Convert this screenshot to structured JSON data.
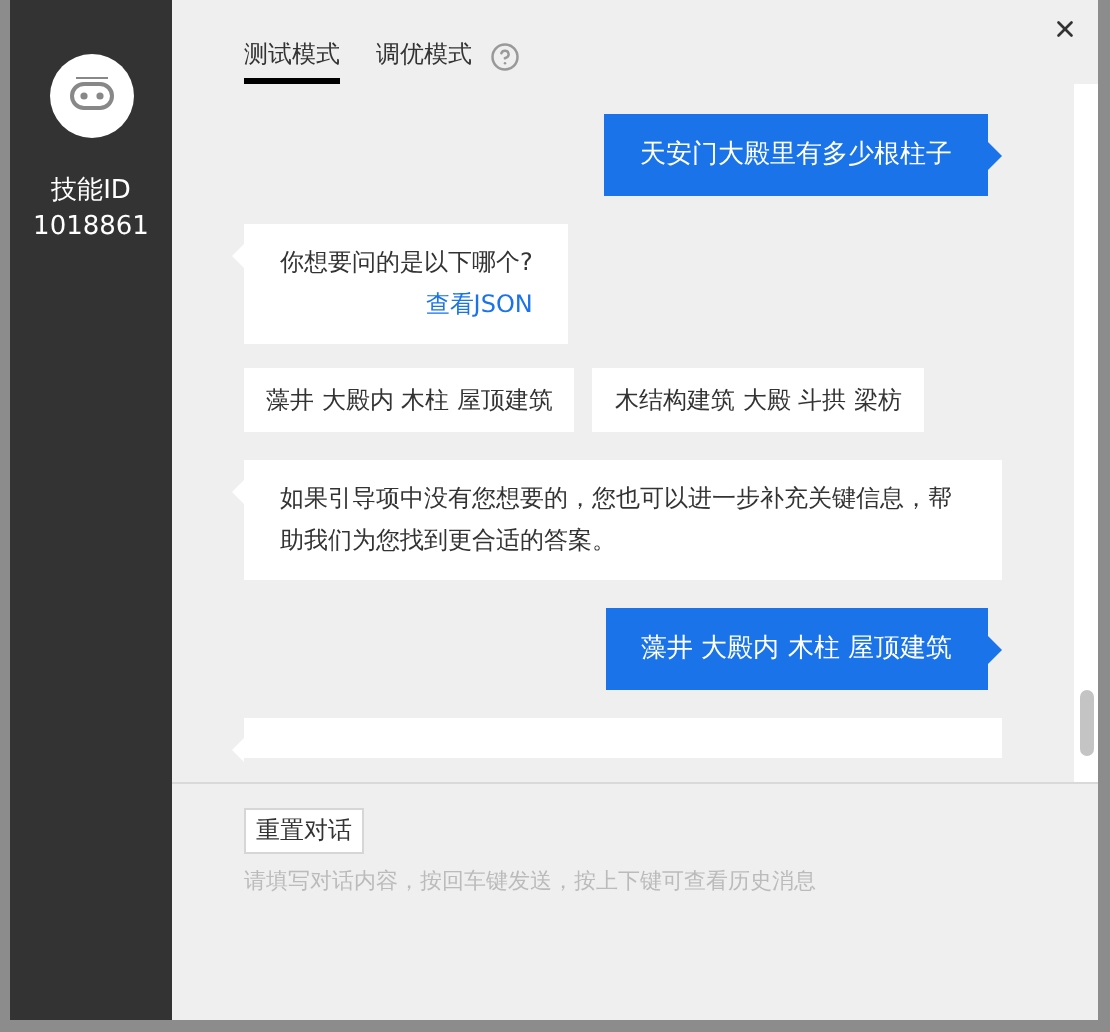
{
  "sidebar": {
    "skill_label": "技能ID",
    "skill_id": "1018861"
  },
  "tabs": [
    {
      "label": "测试模式",
      "selected": true
    },
    {
      "label": "调优模式",
      "selected": false
    }
  ],
  "messages": [
    {
      "kind": "user",
      "text": "天安门大殿里有多少根柱子"
    },
    {
      "kind": "bot",
      "text": "你想要问的是以下哪个?",
      "link": "查看JSON"
    },
    {
      "kind": "options",
      "options": [
        "藻井 大殿内 木柱 屋顶建筑",
        "木结构建筑 大殿 斗拱 梁枋"
      ]
    },
    {
      "kind": "bot",
      "text": "如果引导项中没有您想要的，您也可以进一步补充关键信息，帮助我们为您找到更合适的答案。"
    },
    {
      "kind": "user",
      "text": "藻井 大殿内 木柱 屋顶建筑"
    },
    {
      "kind": "bot"
    }
  ],
  "reset_button": "重置对话",
  "input": {
    "placeholder": "请填写对话内容，按回车键发送，按上下键可查看历史消息"
  }
}
